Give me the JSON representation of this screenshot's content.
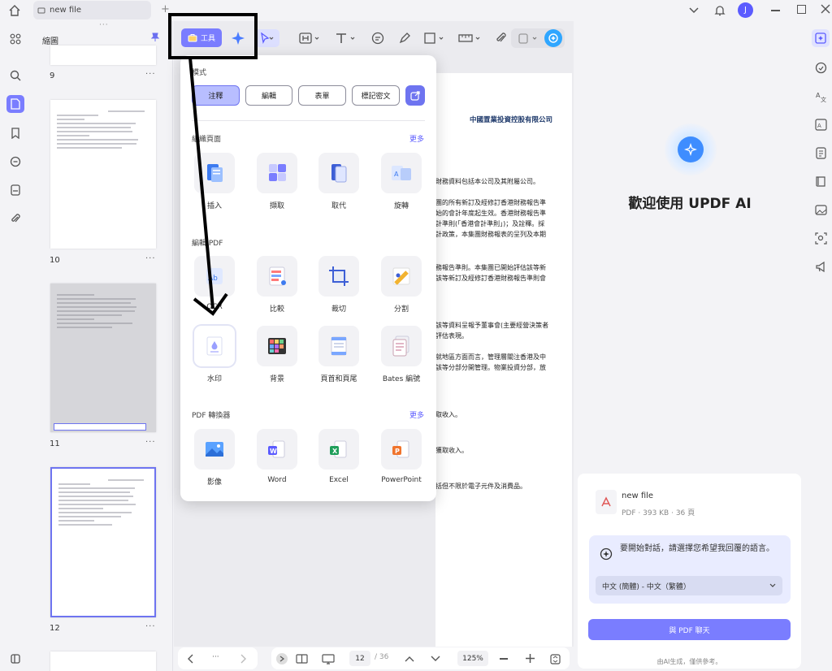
{
  "tab": {
    "title": "new file"
  },
  "thumbnails": {
    "title": "縮圖",
    "pages": [
      {
        "num": "9"
      },
      {
        "num": "10"
      },
      {
        "num": "11"
      },
      {
        "num": "12"
      }
    ],
    "more": "···"
  },
  "toolbar": {
    "tools_label": "工具"
  },
  "document": {
    "lines": [
      "中國置業投資控股有限公司",
      "財務資料包括本公司及其附屬公司。",
      "團的所有新訂及經修訂香港財務報告準",
      "始的會計年度起生效。香港財務報告準",
      "計準則(「香港會計準則」)；及詮釋。採",
      "計政策，本集團財務報表的呈列及本期",
      "務報告準則。本集團已開始評估該等新",
      "該等新訂及經修訂香港財務報告準則會",
      "該等資料呈報予董事會(主要經營決策者",
      "評估表現。",
      "就地區方面而言，管理層關注香港及中",
      "該等分部分開管理。物業投資分部，放",
      "取收入。",
      "獲取收入。",
      "括但不限於電子元件及消費品。"
    ]
  },
  "dropdown": {
    "mode_label": "模式",
    "modes": [
      "注釋",
      "編輯",
      "表單",
      "標記密文"
    ],
    "organize": {
      "title": "組織頁面",
      "more": "更多",
      "tools": [
        "插入",
        "擷取",
        "取代",
        "旋轉"
      ]
    },
    "edit": {
      "title": "編輯 PDF",
      "tools": [
        "OCR",
        "比較",
        "裁切",
        "分割",
        "水印",
        "背景",
        "頁首和頁尾",
        "Bates 編號"
      ]
    },
    "convert": {
      "title": "PDF 轉換器",
      "more": "更多",
      "tools": [
        "影像",
        "Word",
        "Excel",
        "PowerPoint"
      ]
    }
  },
  "bottom": {
    "page_current": "12",
    "page_total": "/ 36",
    "zoom": "125%"
  },
  "ai": {
    "welcome": "歡迎使用 UPDF AI",
    "file_name": "new file",
    "file_meta": "PDF · 393 KB · 36 頁",
    "prompt": "要開始對話，請選擇您希望我回覆的語言。",
    "language": "中文 (簡體) - 中文（繁體）",
    "chat_button": "與 PDF 聊天",
    "footer": "由AI生成，僅供參考。"
  },
  "user": {
    "avatar": "J"
  },
  "colors": {
    "accent": "#7a7dff",
    "highlight_box": "#000000"
  }
}
